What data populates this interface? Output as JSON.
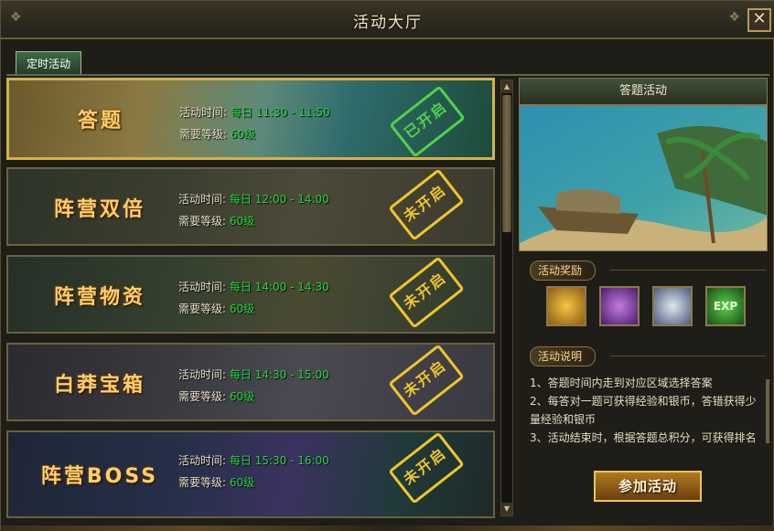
{
  "window": {
    "title": "活动大厅",
    "close_label": "✕"
  },
  "tabs": [
    {
      "label": "定时活动"
    }
  ],
  "activities": [
    {
      "name": "答题",
      "time_label": "活动时间:",
      "time_value": "每日 11:30 - 11:50",
      "level_label": "需要等级:",
      "level_value": "60级",
      "status": "已开启",
      "selected": true
    },
    {
      "name": "阵营双倍",
      "time_label": "活动时间:",
      "time_value": "每日 12:00 - 14:00",
      "level_label": "需要等级:",
      "level_value": "60级",
      "status": "未开启",
      "selected": false
    },
    {
      "name": "阵营物资",
      "time_label": "活动时间:",
      "time_value": "每日 14:00 - 14:30",
      "level_label": "需要等级:",
      "level_value": "60级",
      "status": "未开启",
      "selected": false
    },
    {
      "name": "白莽宝箱",
      "time_label": "活动时间:",
      "time_value": "每日 14:30 - 15:00",
      "level_label": "需要等级:",
      "level_value": "60级",
      "status": "未开启",
      "selected": false
    },
    {
      "name": "阵营BOSS",
      "time_label": "活动时间:",
      "time_value": "每日 15:30 - 16:00",
      "level_label": "需要等级:",
      "level_value": "60级",
      "status": "未开启",
      "selected": false
    }
  ],
  "detail": {
    "title": "答题活动",
    "reward_label": "活动奖励",
    "rewards": [
      {
        "icon": "gold-ingot-icon"
      },
      {
        "icon": "treasure-chest-icon"
      },
      {
        "icon": "silver-coin-icon"
      },
      {
        "icon": "exp-icon",
        "text": "EXP"
      }
    ],
    "desc_label": "活动说明",
    "desc_lines": [
      "1、答题时间内走到对应区域选择答案",
      "2、每答对一题可获得经验和银币，答错获得少量经验和银币",
      "3、活动结束时，根据答题总积分，可获得排名"
    ],
    "join_label": "参加活动"
  },
  "colors": {
    "accent_gold": "#d4b24a",
    "value_green": "#23d63a",
    "stamp_open": "#4fd24a",
    "stamp_closed": "#f1c52a"
  }
}
